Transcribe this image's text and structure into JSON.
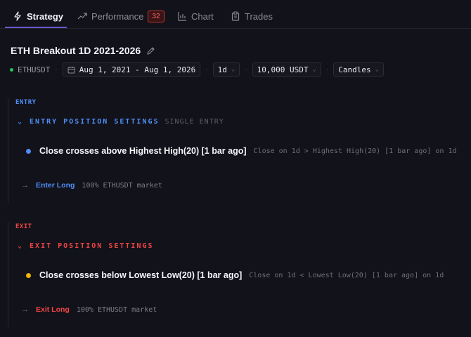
{
  "tabs": [
    {
      "label": "Strategy",
      "icon": "lightning-icon"
    },
    {
      "label": "Performance",
      "icon": "trend-up-icon",
      "badge": "32"
    },
    {
      "label": "Chart",
      "icon": "chart-icon"
    },
    {
      "label": "Trades",
      "icon": "clipboard-icon"
    }
  ],
  "strategy": {
    "title": "ETH Breakout 1D 2021-2026",
    "symbol": "ETHUSDT",
    "date_range": "Aug 1, 2021 - Aug 1, 2026",
    "timeframe": "1d",
    "capital": "10,000 USDT",
    "chart_type": "Candles"
  },
  "entry": {
    "label": "ENTRY",
    "heading": "ENTRY POSITION SETTINGS",
    "sub": "SINGLE ENTRY",
    "condition": "Close crosses above Highest High(20) [1 bar ago]",
    "condition_detail": "Close on 1d > Highest High(20) [1 bar ago] on 1d",
    "action": "Enter Long",
    "action_detail": "100% ETHUSDT market"
  },
  "exit": {
    "label": "EXIT",
    "heading": "EXIT POSITION SETTINGS",
    "condition": "Close crosses below Lowest Low(20) [1 bar ago]",
    "condition_detail": "Close on 1d < Lowest Low(20) [1 bar ago] on 1d",
    "action": "Exit Long",
    "action_detail": "100% ETHUSDT market"
  },
  "colors": {
    "accent": "#6a5acd",
    "entry_blue": "#4f8ef7",
    "exit_red": "#ef4444",
    "status_green": "#22c55e",
    "exit_bullet": "#f5b400"
  }
}
